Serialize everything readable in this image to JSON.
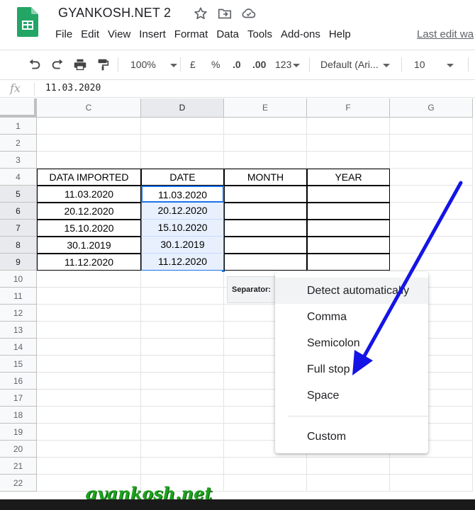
{
  "header": {
    "title": "GYANKOSH.NET 2",
    "last_edit": "Last edit wa",
    "menu": [
      "File",
      "Edit",
      "View",
      "Insert",
      "Format",
      "Data",
      "Tools",
      "Add-ons",
      "Help"
    ]
  },
  "toolbar": {
    "zoom": "100%",
    "currency": "£",
    "percent": "%",
    "dec_decrease": ".0",
    "dec_increase": ".00",
    "number_format": "123",
    "font": "Default (Ari...",
    "font_size": "10"
  },
  "formula_bar": {
    "fx": "fx",
    "value": "11.03.2020"
  },
  "grid": {
    "columns": [
      "C",
      "D",
      "E",
      "F",
      "G"
    ],
    "rows": [
      "1",
      "2",
      "3",
      "4",
      "5",
      "6",
      "7",
      "8",
      "9",
      "10",
      "11",
      "12",
      "13",
      "14",
      "15",
      "16",
      "17",
      "18",
      "19",
      "20",
      "21",
      "22"
    ],
    "table": {
      "headers": [
        "DATA IMPORTED",
        "DATE",
        "MONTH",
        "YEAR"
      ],
      "rows": [
        [
          "11.03.2020",
          "11.03.2020",
          "",
          ""
        ],
        [
          "20.12.2020",
          "20.12.2020",
          "",
          ""
        ],
        [
          "15.10.2020",
          "15.10.2020",
          "",
          ""
        ],
        [
          "30.1.2019",
          "30.1.2019",
          "",
          ""
        ],
        [
          "11.12.2020",
          "11.12.2020",
          "",
          ""
        ]
      ]
    }
  },
  "separator_popup": {
    "label": "Separator:",
    "options": [
      "Detect automatically",
      "Comma",
      "Semicolon",
      "Full stop",
      "Space",
      "Custom"
    ],
    "highlighted": "Detect automatically"
  },
  "colors": {
    "accent": "#1a73e8",
    "arrow": "#1414e6",
    "watermark": "#1ea21e"
  },
  "watermark": "gyankosh.net"
}
